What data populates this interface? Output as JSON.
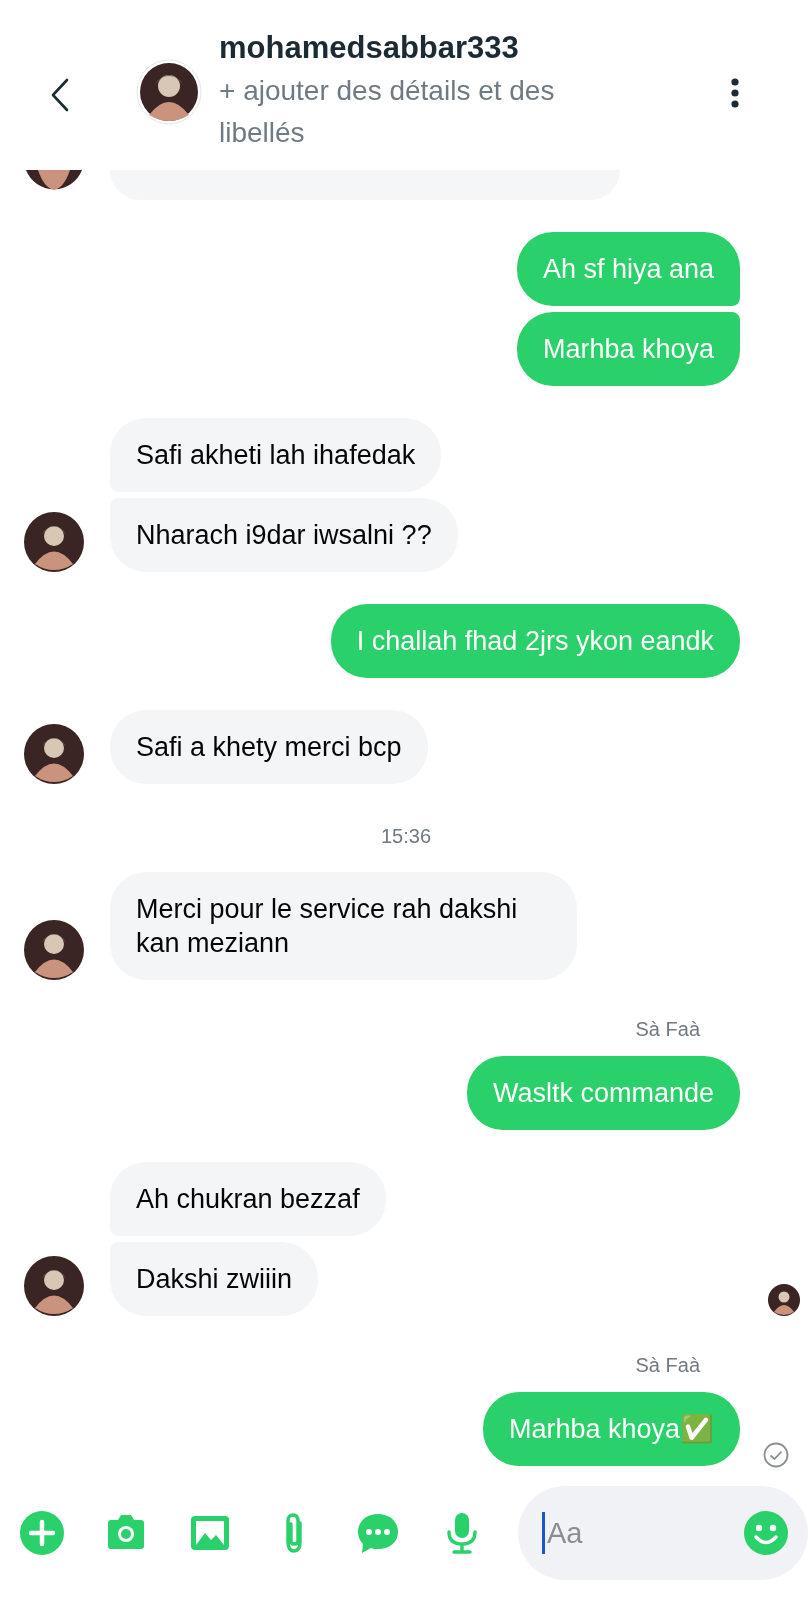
{
  "header": {
    "title": "mohamedsabbar333",
    "subtitle": "+ ajouter des détails et des libellés"
  },
  "messages": [
    {
      "kind": "cut",
      "avatar": true
    },
    {
      "kind": "outgoing",
      "text": "Ah sf hiya ana"
    },
    {
      "kind": "outgoing",
      "text": "Marhba khoya"
    },
    {
      "kind": "incoming",
      "text": "Safi akheti lah ihafedak",
      "avatar": false
    },
    {
      "kind": "incoming",
      "text": "Nharach i9dar iwsalni ??",
      "avatar": true
    },
    {
      "kind": "outgoing",
      "text": "I challah fhad 2jrs ykon eandk"
    },
    {
      "kind": "incoming",
      "text": "Safi a khety merci bcp",
      "avatar": true
    },
    {
      "kind": "timestamp",
      "text": "15:36"
    },
    {
      "kind": "incoming",
      "text": "Merci pour le service rah dakshi kan meziann",
      "avatar": true
    },
    {
      "kind": "sender_label",
      "text": "Sà Faà"
    },
    {
      "kind": "outgoing",
      "text": "Wasltk commande"
    },
    {
      "kind": "incoming",
      "text": "Ah  chukran bezzaf",
      "avatar": false
    },
    {
      "kind": "incoming",
      "text": "Dakshi zwiiin",
      "avatar": true,
      "read_avatar": true
    },
    {
      "kind": "sender_label",
      "text": "Sà Faà"
    },
    {
      "kind": "outgoing",
      "text": "Marhba khoya✅",
      "sent": true
    }
  ],
  "composer": {
    "placeholder": "Aa"
  }
}
